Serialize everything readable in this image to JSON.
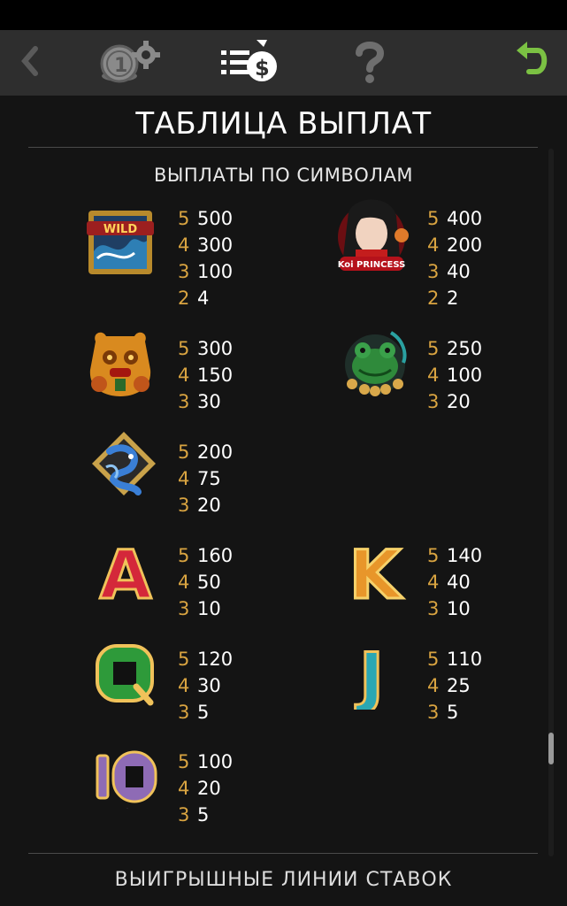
{
  "toolbar": {
    "icons": [
      "back-icon",
      "bet-settings-icon",
      "paytable-icon",
      "help-icon",
      "return-icon"
    ],
    "colors": {
      "active": "#ffffff",
      "inactive": "#7a7a7a",
      "return": "#7bc143"
    }
  },
  "page": {
    "title": "ТАБЛИЦА ВЫПЛАТ",
    "subtitle": "ВЫПЛАТЫ ПО СИМВОЛАМ",
    "next_section": "ВЫИГРЫШНЫЕ ЛИНИИ СТАВОК"
  },
  "symbols": [
    {
      "name": "wild-symbol",
      "icon": "wild-wave-icon",
      "label": "WILD",
      "pays": [
        {
          "count": "5",
          "value": "500"
        },
        {
          "count": "4",
          "value": "300"
        },
        {
          "count": "3",
          "value": "100"
        },
        {
          "count": "2",
          "value": "4"
        }
      ]
    },
    {
      "name": "koi-princess-symbol",
      "icon": "koi-princess-icon",
      "label": "Koi PRINCESS",
      "pays": [
        {
          "count": "5",
          "value": "400"
        },
        {
          "count": "4",
          "value": "200"
        },
        {
          "count": "3",
          "value": "40"
        },
        {
          "count": "2",
          "value": "2"
        }
      ]
    },
    {
      "name": "golden-dragon-symbol",
      "icon": "golden-dragon-icon",
      "pays": [
        {
          "count": "5",
          "value": "300"
        },
        {
          "count": "4",
          "value": "150"
        },
        {
          "count": "3",
          "value": "30"
        }
      ]
    },
    {
      "name": "jade-frog-symbol",
      "icon": "jade-frog-icon",
      "pays": [
        {
          "count": "5",
          "value": "250"
        },
        {
          "count": "4",
          "value": "100"
        },
        {
          "count": "3",
          "value": "20"
        }
      ]
    },
    {
      "name": "blue-koi-symbol",
      "icon": "blue-koi-icon",
      "pays": [
        {
          "count": "5",
          "value": "200"
        },
        {
          "count": "4",
          "value": "75"
        },
        {
          "count": "3",
          "value": "20"
        }
      ]
    },
    {
      "name": "letter-a-symbol",
      "icon": "letter-a-icon",
      "label": "A",
      "pays": [
        {
          "count": "5",
          "value": "160"
        },
        {
          "count": "4",
          "value": "50"
        },
        {
          "count": "3",
          "value": "10"
        }
      ]
    },
    {
      "name": "letter-k-symbol",
      "icon": "letter-k-icon",
      "label": "K",
      "pays": [
        {
          "count": "5",
          "value": "140"
        },
        {
          "count": "4",
          "value": "40"
        },
        {
          "count": "3",
          "value": "10"
        }
      ]
    },
    {
      "name": "letter-q-symbol",
      "icon": "letter-q-icon",
      "label": "Q",
      "pays": [
        {
          "count": "5",
          "value": "120"
        },
        {
          "count": "4",
          "value": "30"
        },
        {
          "count": "3",
          "value": "5"
        }
      ]
    },
    {
      "name": "letter-j-symbol",
      "icon": "letter-j-icon",
      "label": "J",
      "pays": [
        {
          "count": "5",
          "value": "110"
        },
        {
          "count": "4",
          "value": "25"
        },
        {
          "count": "3",
          "value": "5"
        }
      ]
    },
    {
      "name": "ten-symbol",
      "icon": "ten-icon",
      "label": "10",
      "pays": [
        {
          "count": "5",
          "value": "100"
        },
        {
          "count": "4",
          "value": "20"
        },
        {
          "count": "3",
          "value": "5"
        }
      ]
    }
  ]
}
